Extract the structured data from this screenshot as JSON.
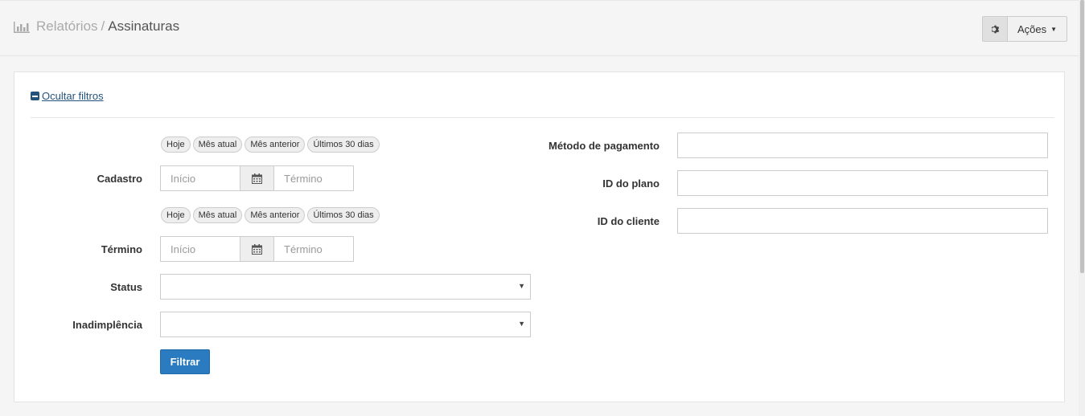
{
  "header": {
    "breadcrumb_parent": "Relatórios",
    "breadcrumb_sep": "/",
    "breadcrumb_current": "Assinaturas",
    "actions_label": "Ações"
  },
  "filters": {
    "toggle_label": "Ocultar filtros",
    "cadastro": {
      "label": "Cadastro",
      "quick": [
        "Hoje",
        "Mês atual",
        "Mês anterior",
        "Últimos 30 dias"
      ],
      "start_placeholder": "Início",
      "end_placeholder": "Término"
    },
    "termino": {
      "label": "Término",
      "quick": [
        "Hoje",
        "Mês atual",
        "Mês anterior",
        "Últimos 30 dias"
      ],
      "start_placeholder": "Início",
      "end_placeholder": "Término"
    },
    "status": {
      "label": "Status",
      "value": ""
    },
    "inadimplencia": {
      "label": "Inadimplência",
      "value": ""
    },
    "metodo_pagamento": {
      "label": "Método de pagamento",
      "value": ""
    },
    "id_plano": {
      "label": "ID do plano",
      "value": ""
    },
    "id_cliente": {
      "label": "ID do cliente",
      "value": ""
    },
    "submit_label": "Filtrar"
  },
  "colors": {
    "primary": "#2a7bbf",
    "link": "#23527c"
  },
  "icons": [
    "bar-chart-icon",
    "gear-icon",
    "minus-square-icon",
    "calendar-icon",
    "caret-down-icon"
  ]
}
